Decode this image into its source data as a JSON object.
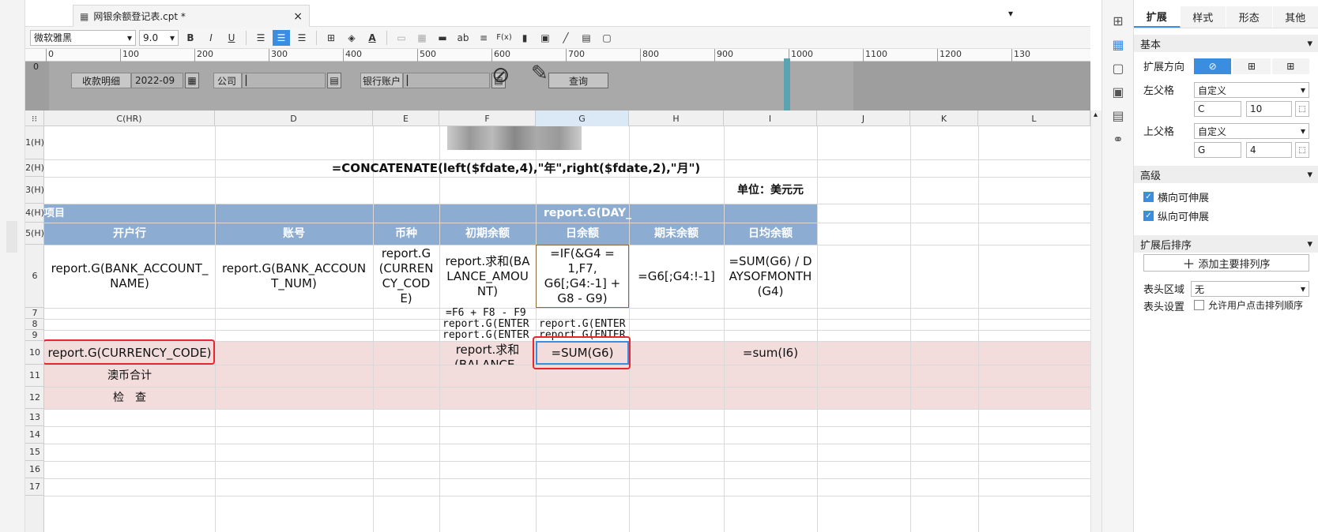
{
  "tab": {
    "title": "网银余额登记表.cpt *",
    "close": "×"
  },
  "toolbar": {
    "font_name": "微软雅黑",
    "font_size": "9.0",
    "bold": "B",
    "italic": "I",
    "underline": "U",
    "font_color_label": "A",
    "text_label": "ab",
    "formula_label": "F(x)"
  },
  "ruler": {
    "ticks": [
      "0",
      "100",
      "200",
      "300",
      "400",
      "500",
      "600",
      "700",
      "800",
      "900",
      "1000",
      "1100",
      "1200",
      "130"
    ]
  },
  "params": {
    "start": "0",
    "receive_label": "收款明细",
    "date_value": "2022-09",
    "company_label": "公司",
    "bank_label": "银行账户",
    "query_label": "查询"
  },
  "columns": [
    "C(HR)",
    "D",
    "E",
    "F",
    "G",
    "H",
    "I",
    "J",
    "K",
    "L"
  ],
  "rows": [
    "1(H)",
    "2(H)",
    "3(H)",
    "4(H)",
    "5(H)",
    "6",
    "7",
    "8",
    "9",
    "10",
    "11",
    "12",
    "13",
    "14",
    "15",
    "16",
    "17"
  ],
  "cells": {
    "title_formula": "=CONCATENATE(left($fdate,4),\"年\",right($fdate,2),\"月\")",
    "unit": "单位：美元元",
    "r4_left": "项目",
    "r4_day": "report.G(DAY_",
    "h_bank": "开户行",
    "h_account": "账号",
    "h_currency": "币种",
    "h_initial": "初期余额",
    "h_daily": "日余额",
    "h_end": "期末余额",
    "h_avg": "日均余额",
    "r6_bank": "report.G(BANK_ACCOUNT_NAME)",
    "r6_account": "report.G(BANK_ACCOUNT_NUM)",
    "r6_currency": "report.G(CURRENCY_CODE)",
    "r6_initial": "report.求和(BALANCE_AMOUNT)",
    "r6_daily": "=IF(&G4 = 1,F7, G6[;G4:-1] + G8 - G9)",
    "r6_end": "=G6[;G4:!-1]",
    "r6_avg": "=SUM(G6) / DAYSOFMONTH(G4)",
    "r7_f": "=F6 + F8 - F9",
    "r8_f": "report.G(ENTER",
    "r8_g": "report.G(ENTER",
    "r9_f": "report.G(ENTER",
    "r9_g": "report.G(ENTER",
    "r10_c": "report.G(CURRENCY_CODE)",
    "r10_f": "report.求和(BALANCE_",
    "r10_g": "=SUM(G6)",
    "r10_i": "=sum(I6)",
    "r11_c": "澳币合计",
    "r12_c": "检　查"
  },
  "right_panel": {
    "tabs": [
      "扩展",
      "样式",
      "形态",
      "其他"
    ],
    "section_basic": "基本",
    "expand_dir_label": "扩展方向",
    "left_parent_label": "左父格",
    "left_parent_mode": "自定义",
    "left_parent_col": "C",
    "left_parent_row": "10",
    "top_parent_label": "上父格",
    "top_parent_mode": "自定义",
    "top_parent_col": "G",
    "top_parent_row": "4",
    "section_advanced": "高级",
    "h_expand": "横向可伸展",
    "v_expand": "纵向可伸展",
    "section_sort": "扩展后排序",
    "add_sort": "添加主要排列序",
    "header_area_label": "表头区域",
    "header_area_value": "无",
    "header_setting_label": "表头设置",
    "allow_sort": "允许用户点击排列顺序"
  },
  "colors": {
    "accent": "#3b8de0",
    "header_blue": "#8cacd2",
    "pink": "#f2dcdc",
    "highlight_red": "#e8262b"
  }
}
